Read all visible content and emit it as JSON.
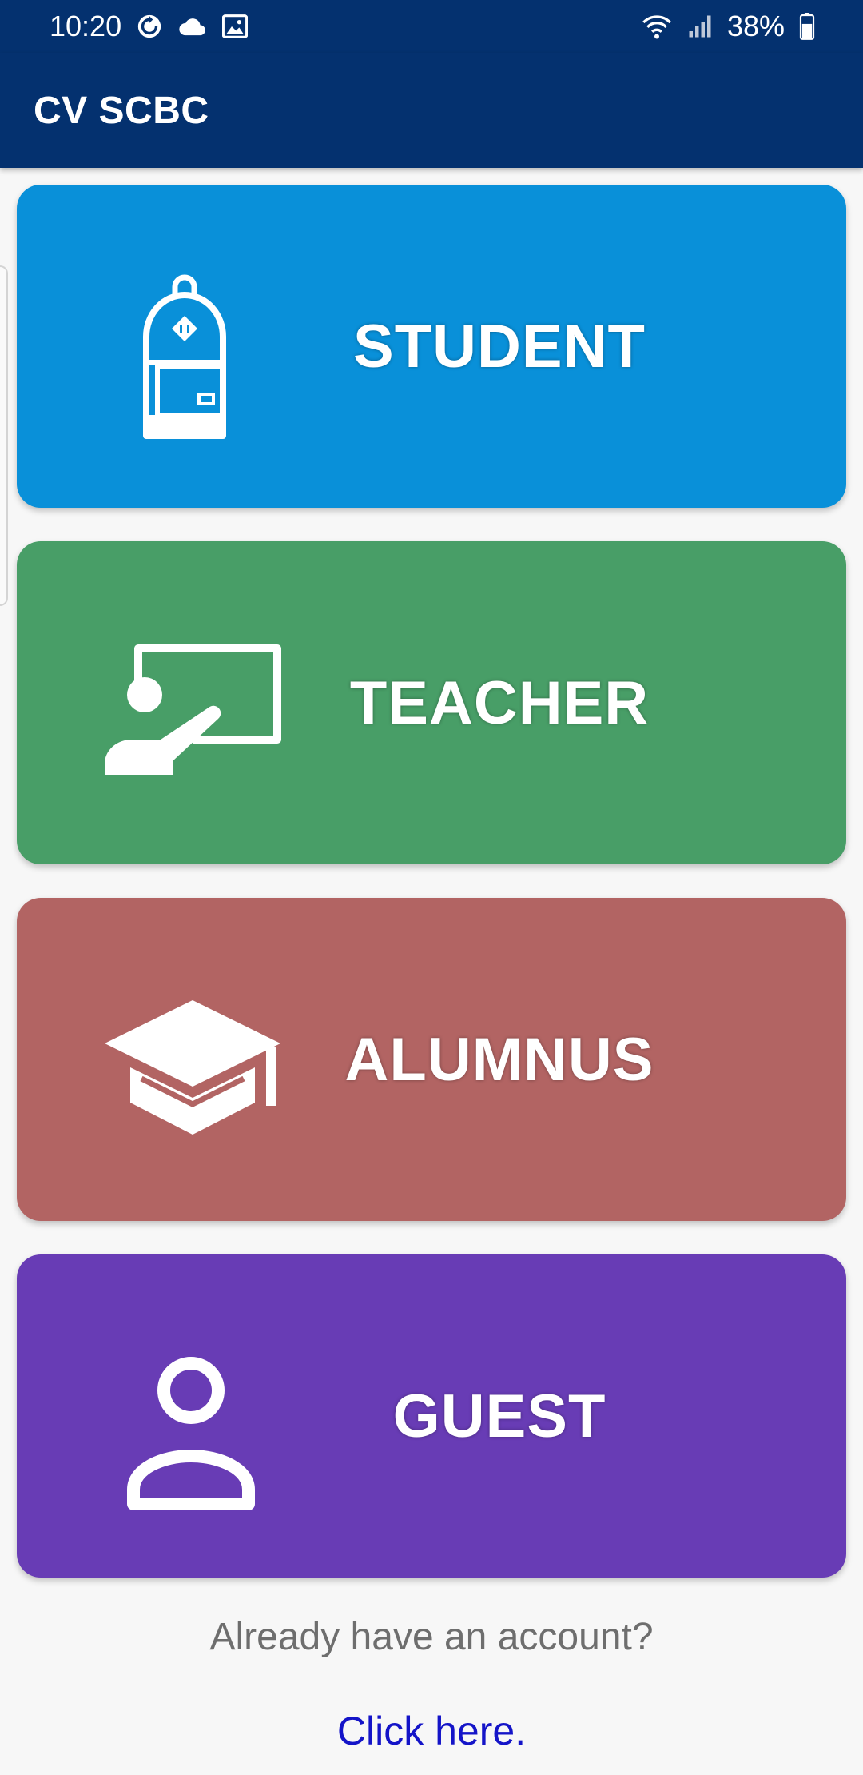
{
  "status_bar": {
    "time": "10:20",
    "battery": "38%",
    "left_icons": [
      "sync-icon",
      "cloud-icon",
      "image-icon"
    ],
    "right_icons": [
      "wifi-icon",
      "signal-icon",
      "battery-icon"
    ]
  },
  "app_bar": {
    "title": "CV SCBC"
  },
  "roles": [
    {
      "label": "STUDENT",
      "icon": "backpack-icon",
      "color": "#0990d9"
    },
    {
      "label": "TEACHER",
      "icon": "teacher-board-icon",
      "color": "#489e67"
    },
    {
      "label": "ALUMNUS",
      "icon": "graduation-cap-icon",
      "color": "#b26463"
    },
    {
      "label": "GUEST",
      "icon": "person-icon",
      "color": "#683cb5"
    }
  ],
  "footer": {
    "prompt": "Already have an account?",
    "link": "Click here."
  },
  "colors": {
    "app_bar": "#04316f",
    "background": "#f7f7f7",
    "link": "#1414c8",
    "prompt_text": "#6e6e6e"
  }
}
